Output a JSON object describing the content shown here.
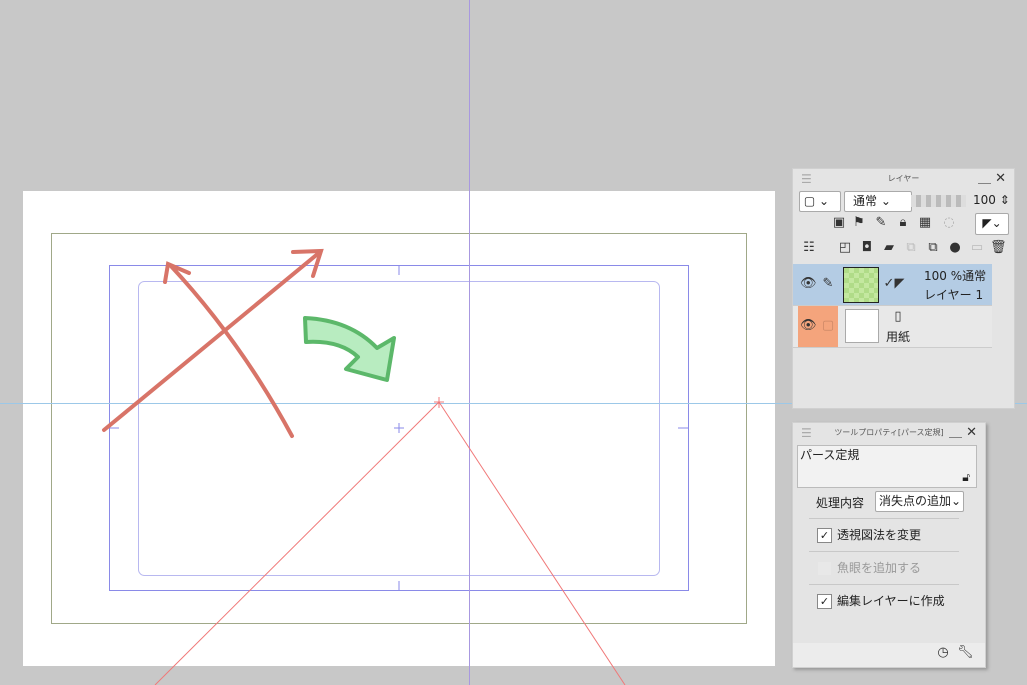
{
  "layer_panel": {
    "title": "レイヤー",
    "blend_mode": "通常",
    "opacity": "100",
    "layers": [
      {
        "name": "レイヤー 1",
        "info": "100 %通常",
        "selected": true
      },
      {
        "name": "用紙",
        "paper": true
      }
    ]
  },
  "tool_property": {
    "title": "ツールプロパティ[パース定規]",
    "tool_name": "パース定規",
    "process_label": "処理内容",
    "process_value": "消失点の追加",
    "options": [
      {
        "label": "透視図法を変更",
        "checked": true,
        "enabled": true
      },
      {
        "label": "魚眼を追加する",
        "checked": false,
        "enabled": false
      },
      {
        "label": "編集レイヤーに作成",
        "checked": true,
        "enabled": true
      }
    ]
  },
  "colors": {
    "selected_layer": "#b4cce4",
    "paper_layer": "#f4a47c",
    "arrow_red": "#d87468",
    "arrow_green": "#5cb86a"
  }
}
